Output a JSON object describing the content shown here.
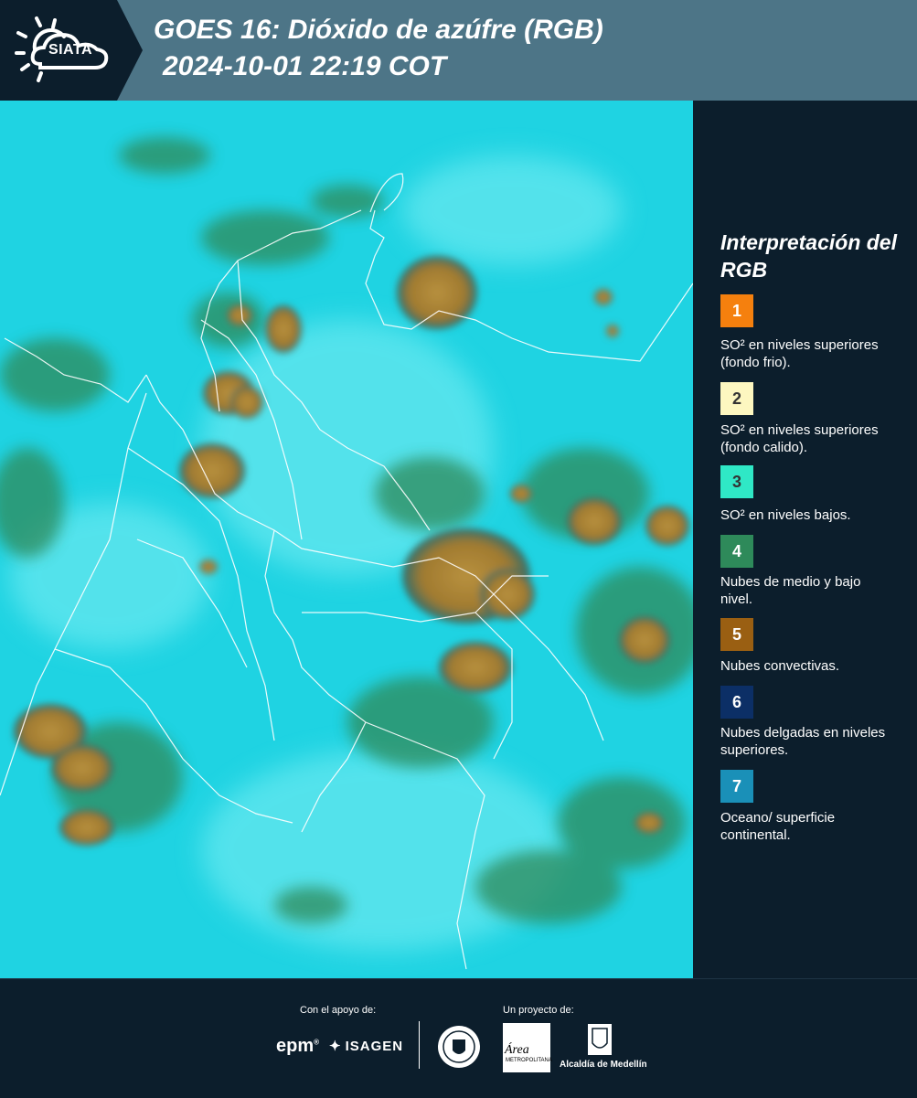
{
  "header": {
    "logo_text": "SIATA",
    "title_line1": "GOES 16: Dióxido de azúfre (RGB)",
    "title_line2": "2024-10-01 22:19 COT",
    "background_color": "#4d7587"
  },
  "map": {
    "image": "GOES-16 SO2 RGB satellite composite over Colombia",
    "base_color": "#1fd8e6",
    "convective_color": "#a57f33",
    "border_color": "#ffffff"
  },
  "legend": {
    "title": "Interpretación del RGB",
    "items": [
      {
        "number": "1",
        "color": "#f5800e",
        "label": "SO² en niveles superiores (fondo frio)."
      },
      {
        "number": "2",
        "color": "#fdf7c0",
        "label": "SO² en niveles superiores (fondo calido)."
      },
      {
        "number": "3",
        "color": "#2fe8c6",
        "label": "SO² en niveles bajos."
      },
      {
        "number": "4",
        "color": "#2e8a5a",
        "label": "Nubes de medio y bajo nivel."
      },
      {
        "number": "5",
        "color": "#9a5f12",
        "label": "Nubes convectivas."
      },
      {
        "number": "6",
        "color": "#0c2f66",
        "label": "Nubes delgadas en niveles superiores."
      },
      {
        "number": "7",
        "color": "#1a90b8",
        "label": "Oceano/ superficie continental."
      }
    ]
  },
  "footer": {
    "support_label": "Con el apoyo de:",
    "project_label": "Un proyecto de:",
    "epm_logo": "epm",
    "isagen_logo": "ISAGEN",
    "area_logo": "Área",
    "area_subtitle": "METROPOLITANA",
    "alcaldia_label": "Alcaldía de Medellín"
  }
}
